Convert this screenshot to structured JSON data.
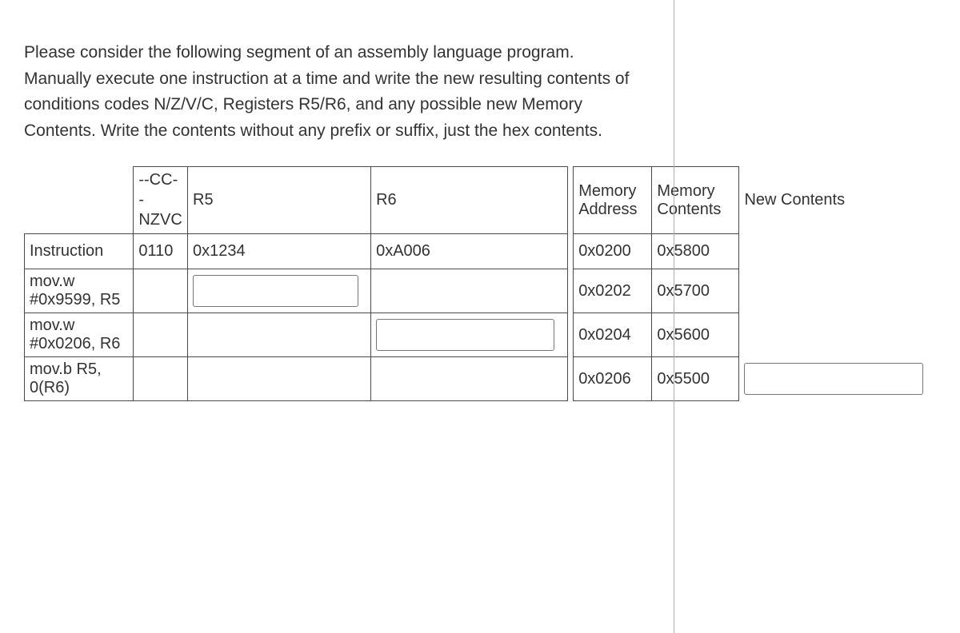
{
  "prompt": "Please consider the following  segment of an assembly language program. Manually execute one instruction at a time and write the new resulting contents of conditions codes N/Z/V/C, Registers R5/R6, and any possible new Memory Contents. Write the contents without any prefix or suffix, just the hex contents.",
  "headers": {
    "cc_top": "--CC-",
    "cc_mid": "-",
    "cc_bot": "NZVC",
    "r5": "R5",
    "r6": "R6",
    "mem_addr": "Memory Address",
    "mem_cont": "Memory Contents",
    "new_cont": "New Contents",
    "instruction": "Instruction"
  },
  "initial": {
    "cc": "0110",
    "r5": "0x1234",
    "r6": "0xA006"
  },
  "instr": {
    "row1": "mov.w #0x9599, R5",
    "row2": "mov.w #0x0206, R6",
    "row3": "mov.b  R5, 0(R6)"
  },
  "mem": {
    "r0": {
      "addr": "0x0200",
      "cont": "0x5800"
    },
    "r1": {
      "addr": "0x0202",
      "cont": "0x5700"
    },
    "r2": {
      "addr": "0x0204",
      "cont": "0x5600"
    },
    "r3": {
      "addr": "0x0206",
      "cont": "0x5500"
    }
  }
}
